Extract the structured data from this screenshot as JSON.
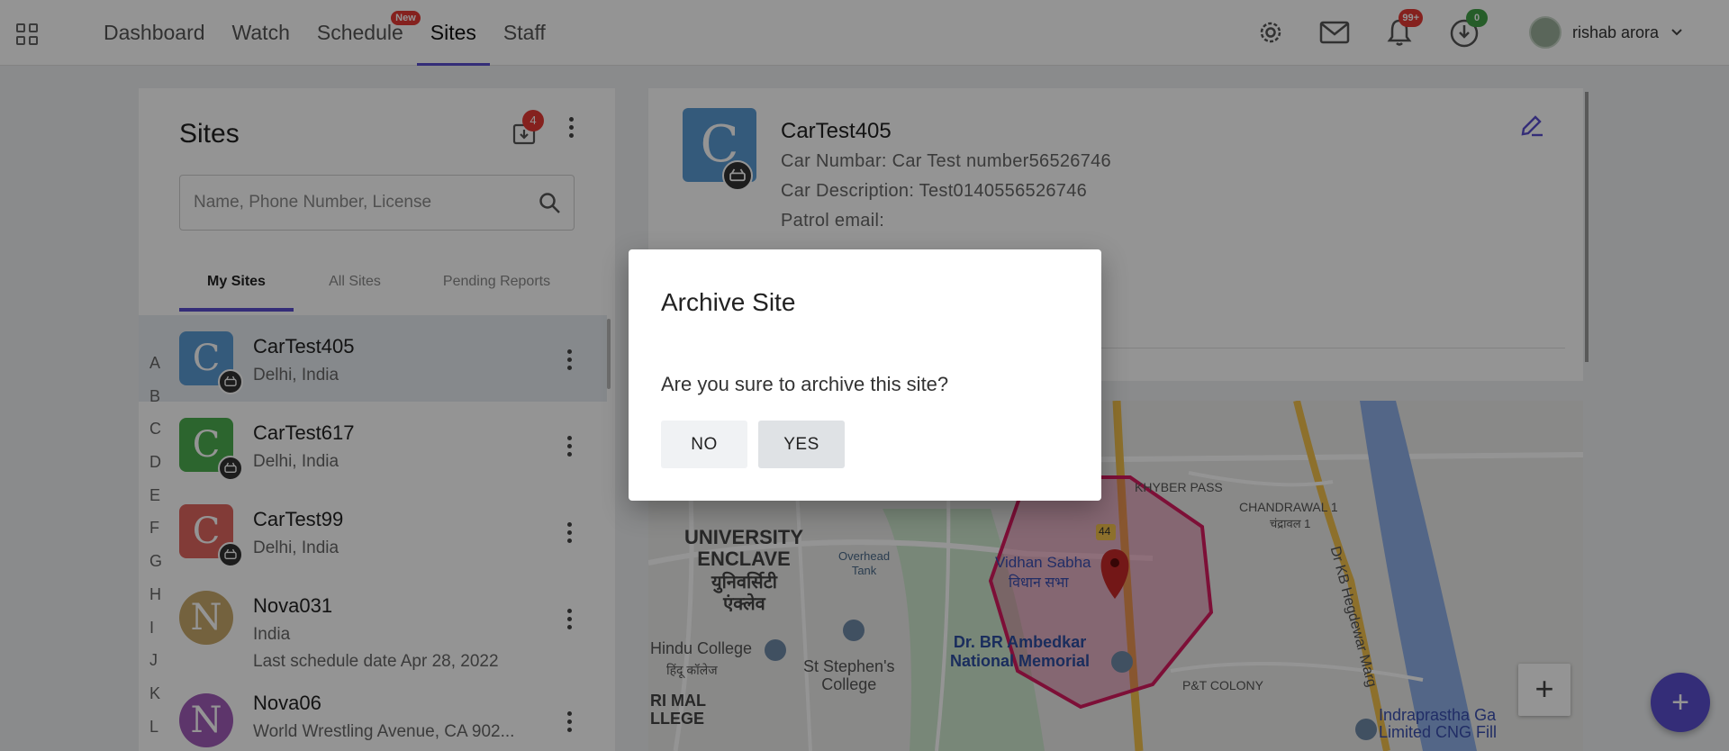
{
  "nav": {
    "items": [
      {
        "label": "Dashboard"
      },
      {
        "label": "Watch"
      },
      {
        "label": "Schedule",
        "badge": "New"
      },
      {
        "label": "Sites",
        "active": true
      },
      {
        "label": "Staff"
      }
    ],
    "notifications_count": "99+",
    "downloads_count": "0",
    "user_name": "rishab arora"
  },
  "sites": {
    "title": "Sites",
    "inbox_count": "4",
    "search_placeholder": "Name, Phone Number, License",
    "tabs": [
      "My Sites",
      "All Sites",
      "Pending Reports"
    ],
    "alphabet": [
      "A",
      "B",
      "C",
      "D",
      "E",
      "F",
      "G",
      "H",
      "I",
      "J",
      "K",
      "L"
    ],
    "items": [
      {
        "initial": "C",
        "name": "CarTest405",
        "location": "Delhi, India",
        "color": "#5b9bd5"
      },
      {
        "initial": "C",
        "name": "CarTest617",
        "location": "Delhi, India",
        "color": "#4caf50"
      },
      {
        "initial": "C",
        "name": "CarTest99",
        "location": "Delhi, India",
        "color": "#e06660"
      },
      {
        "initial": "N",
        "name": "Nova031",
        "location": "India",
        "extra": "Last schedule date Apr 28, 2022",
        "color": "#c9a96b"
      },
      {
        "initial": "N",
        "name": "Nova06",
        "location": "World Wrestling Avenue, CA 902...",
        "color": "#a05cb8"
      }
    ]
  },
  "details": {
    "initial": "C",
    "name": "CarTest405",
    "car_number": "Car Numbar: Car Test number56526746",
    "car_description": "Car Description: Test0140556526746",
    "patrol_email": "Patrol email:"
  },
  "map": {
    "labels": {
      "university_enclave": "UNIVERSITY\nENCLAVE",
      "univ_hindi": "युनिवर्सिटी\nएंक्लेव",
      "hindu_college": "Hindu College",
      "hindu_college_hi": "हिंदू कॉलेज",
      "st_stephens": "St Stephen's\nCollege",
      "overhead_tank": "Overhead\nTank",
      "vidhan_sabha": "Vidhan Sabha",
      "vidhan_sabha_hi": "विधान सभा",
      "ambedkar": "Dr. BR Ambedkar\nNational Memorial",
      "khyber_pass": "KHYBER PASS",
      "chandrawal": "CHANDRAWAL 1",
      "chandrawal_hi": "चंद्रावल 1",
      "hedgewar": "Dr KB Hegdewar Marg",
      "pt_colony": "P&T COLONY",
      "indraprastha": "Indraprastha Ga\nLimited CNG Fill",
      "kirori_mal": "RI MAL\nLLEGE",
      "road_44": "44"
    },
    "accent_polygon": "#d81b60"
  },
  "dialog": {
    "title": "Archive Site",
    "message": "Are you sure to archive this site?",
    "no_label": "NO",
    "yes_label": "YES"
  },
  "colors": {
    "accent": "#5a4fcf",
    "badge_red": "#e53935",
    "badge_green": "#43a047"
  }
}
